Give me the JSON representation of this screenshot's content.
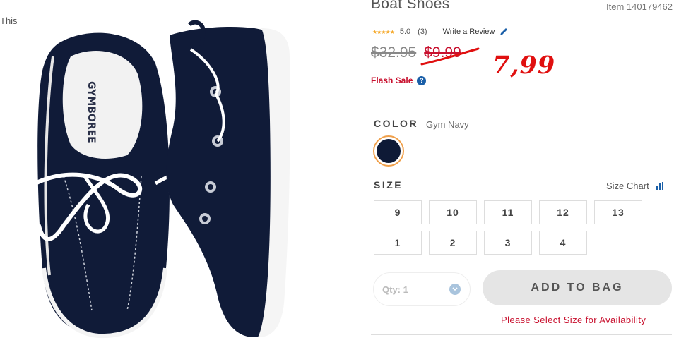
{
  "left_link": "This",
  "product": {
    "title": "Boat Shoes",
    "item_number": "Item 140179462",
    "rating": {
      "stars": "★★★★★",
      "score": "5.0",
      "count": "(3)",
      "write_review": "Write a Review"
    },
    "prices": {
      "original": "$32.95",
      "sale": "$9.99",
      "handwritten_new": "7,99"
    },
    "flash_sale": "Flash Sale",
    "help_icon": "?"
  },
  "color": {
    "label": "COLOR",
    "value": "Gym Navy",
    "swatch_hex": "#0e1a36"
  },
  "size": {
    "label": "SIZE",
    "size_chart": "Size Chart",
    "options": [
      "9",
      "10",
      "11",
      "12",
      "13",
      "1",
      "2",
      "3",
      "4"
    ]
  },
  "purchase": {
    "qty_label": "Qty: 1",
    "add_to_bag": "ADD TO BAG",
    "availability_msg": "Please Select Size for Availability"
  },
  "colors": {
    "accent_red": "#c8102e",
    "handwritten_red": "#e01010",
    "navy": "#0e1a36",
    "swatch_ring": "#f0a04b"
  }
}
